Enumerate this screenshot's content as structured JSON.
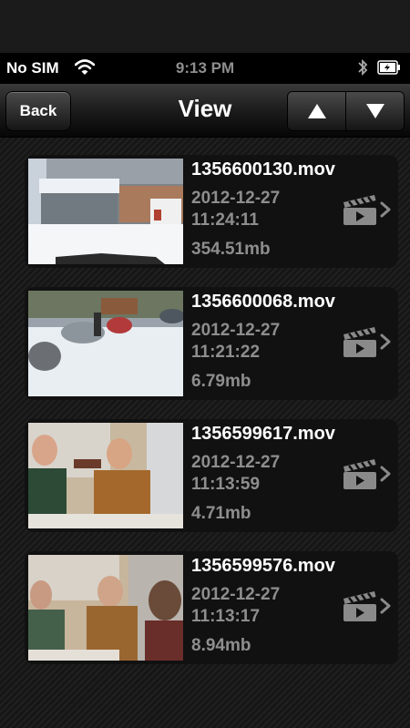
{
  "status_bar": {
    "carrier": "No SIM",
    "time": "9:13 PM",
    "icons": [
      "wifi-icon",
      "bluetooth-icon",
      "battery-charging-icon"
    ]
  },
  "nav": {
    "back_label": "Back",
    "title": "View",
    "segment_icons": [
      "up-arrow-icon",
      "down-arrow-icon"
    ]
  },
  "videos": [
    {
      "filename": "1356600130.mov",
      "date": "2012-12-27",
      "time": "11:24:11",
      "size": "354.51mb"
    },
    {
      "filename": "1356600068.mov",
      "date": "2012-12-27",
      "time": "11:21:22",
      "size": "6.79mb"
    },
    {
      "filename": "1356599617.mov",
      "date": "2012-12-27",
      "time": "11:13:59",
      "size": "4.71mb"
    },
    {
      "filename": "1356599576.mov",
      "date": "2012-12-27",
      "time": "11:13:17",
      "size": "8.94mb"
    }
  ],
  "colors": {
    "background": "#1b1b1b",
    "card": "#111111",
    "text_primary": "#ffffff",
    "text_secondary": "#8e8e8e"
  }
}
